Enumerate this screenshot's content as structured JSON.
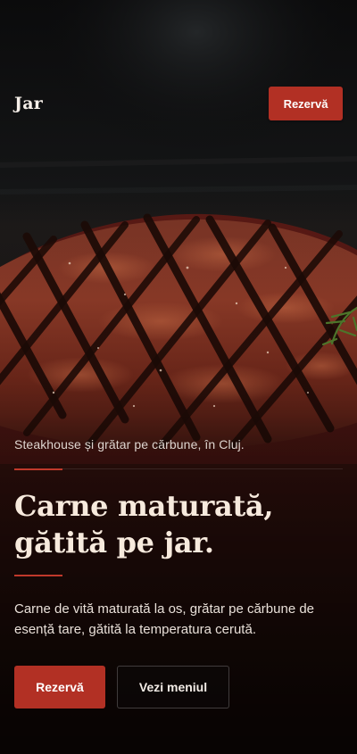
{
  "header": {
    "brand": "Jar",
    "reserve_label": "Rezervă"
  },
  "hero": {
    "image": "grilled-steak-photo",
    "tagline": "Steakhouse și grătar pe cărbune, în Cluj.",
    "headline_line1": "Carne maturată,",
    "headline_line2": "gătită pe jar.",
    "description": "Carne de vită maturată la os, grătar pe cărbune de esență tare, gătită la temperatura cerută."
  },
  "actions": {
    "primary_label": "Rezervă",
    "secondary_label": "Vezi meniul"
  },
  "colors": {
    "accent": "#b23024",
    "background": "#0f0c0b",
    "headline": "#f7eadd"
  }
}
